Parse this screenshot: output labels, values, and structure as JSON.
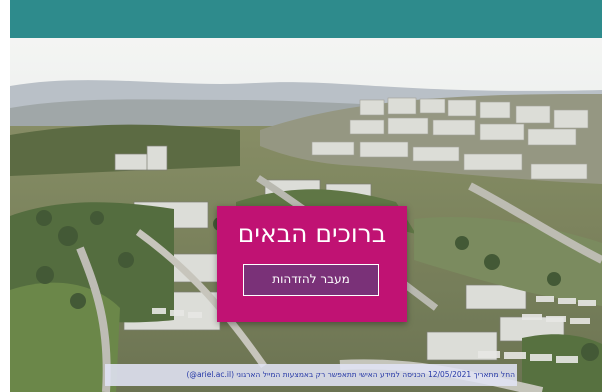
{
  "header": {
    "color": "#2e8b8c"
  },
  "login_card": {
    "title": "ברוכים הבאים",
    "button_label": "מעבר להזדהות",
    "background_color": "#c01273",
    "button_color": "#7a3178"
  },
  "notice": {
    "text": "החל מתאריך 12/05/2021 הכניסה למידע האישי תתאפשר רק באמצעות המייל הארגוני (ariel.ac.il@)"
  }
}
